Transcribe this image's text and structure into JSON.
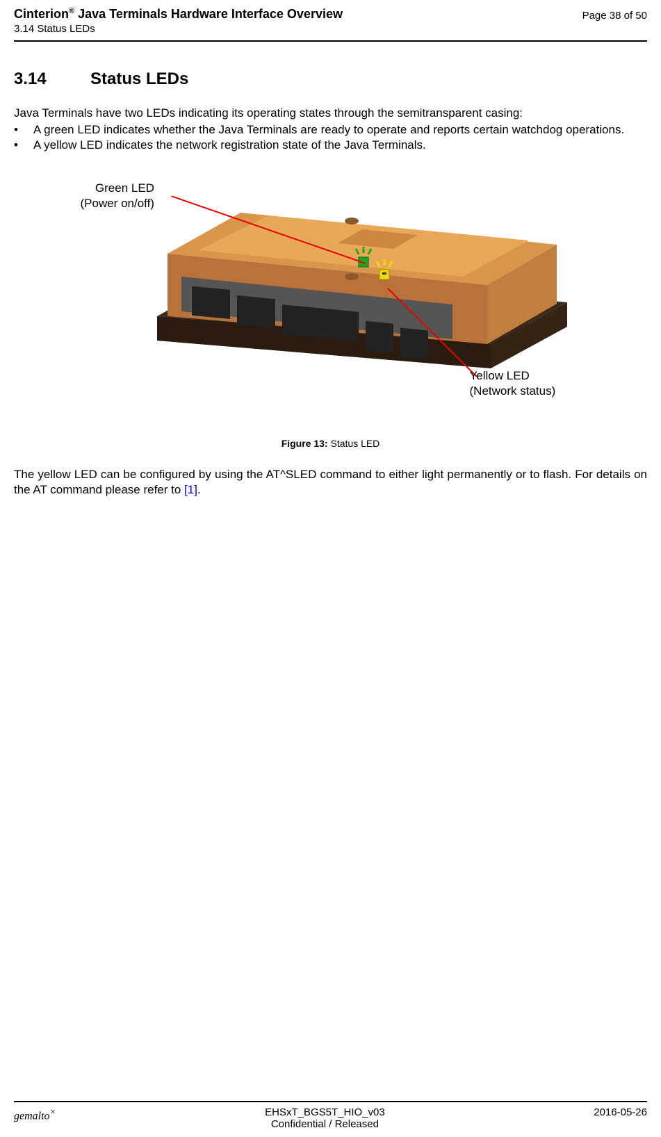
{
  "header": {
    "title_prefix": "Cinterion",
    "title_sup": "®",
    "title_suffix": " Java Terminals Hardware Interface Overview",
    "subtitle": "3.14 Status LEDs",
    "page_info": "Page 38 of 50"
  },
  "section": {
    "number": "3.14",
    "title": "Status LEDs",
    "intro": "Java Terminals have two LEDs indicating its operating states through the semitransparent casing:",
    "bullets": [
      "A green LED indicates whether the Java Terminals are ready to operate and reports certain watchdog operations.",
      "A yellow LED indicates the network registration state of the Java Terminals."
    ],
    "para2_pre": "The yellow LED can be configured by using the AT^SLED command to either light permanently or to flash. For details on the AT command please refer to ",
    "para2_ref": "[1]",
    "para2_post": "."
  },
  "figure": {
    "green_label_l1": "Green LED",
    "green_label_l2": "(Power on/off)",
    "yellow_label_l1": "Yellow LED",
    "yellow_label_l2": "(Network status)",
    "caption_bold": "Figure 13:",
    "caption_text": "  Status LED"
  },
  "footer": {
    "logo": "gemalto",
    "logo_sup": "×",
    "doc_id": "EHSxT_BGS5T_HIO_v03",
    "confidentiality": "Confidential / Released",
    "date": "2016-05-26"
  }
}
